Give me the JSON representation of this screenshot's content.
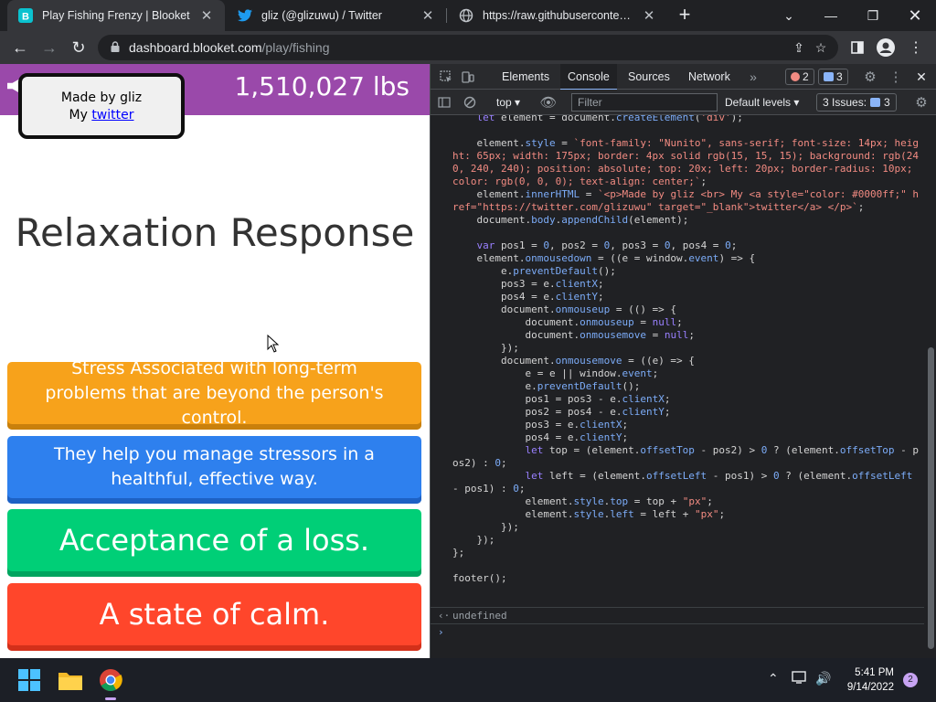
{
  "browser": {
    "tabs": [
      {
        "title": "Play Fishing Frenzy | Blooket",
        "icon": "blooket-icon",
        "active": true
      },
      {
        "title": "gliz (@glizuwu) / Twitter",
        "icon": "twitter-icon",
        "active": false
      },
      {
        "title": "https://raw.githubusercontent.co",
        "icon": "globe-icon",
        "active": false
      }
    ],
    "url_host": "dashboard.blooket.com",
    "url_path": "/play/fishing"
  },
  "game": {
    "weight": "1,510,027 lbs",
    "credit_line1": "Made by gliz",
    "credit_prefix": "My",
    "credit_link": "twitter",
    "question": "Relaxation Response",
    "answers": [
      {
        "text": "Stress Associated with long-term problems that are beyond the person's control.",
        "color": "#f7a21b",
        "shadow": "#c9800c"
      },
      {
        "text": "They help you manage stressors in a healthful, effective way.",
        "color": "#2e80ee",
        "shadow": "#1d61c4"
      },
      {
        "text": "Acceptance of a loss.",
        "color": "#00cf77",
        "shadow": "#00a45f"
      },
      {
        "text": "A state of calm.",
        "color": "#ff462b",
        "shadow": "#d3301a"
      }
    ]
  },
  "devtools": {
    "tabs": [
      "Elements",
      "Console",
      "Sources",
      "Network"
    ],
    "active_tab": "Console",
    "error_count": "2",
    "message_count": "3",
    "context": "top",
    "filter_placeholder": "Filter",
    "levels": "Default levels",
    "issues_label": "3 Issues:",
    "issues_count": "3",
    "result": "undefined"
  },
  "taskbar": {
    "time": "5:41 PM",
    "date": "9/14/2022",
    "notifications": "2"
  }
}
